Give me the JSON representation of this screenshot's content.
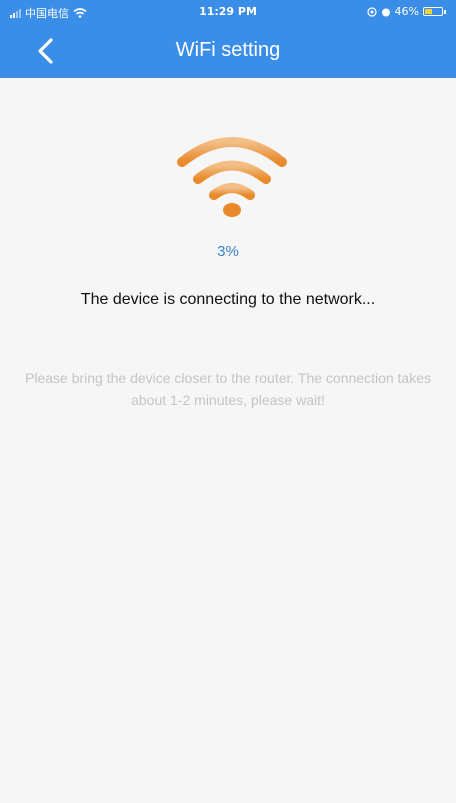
{
  "status_bar": {
    "carrier": "中国电信",
    "time": "11:29 PM",
    "battery": "46%",
    "battery_level": 0.46
  },
  "nav": {
    "title": "WiFi setting",
    "back_icon": "chevron-left-icon"
  },
  "main": {
    "wifi_icon": "wifi-icon",
    "wifi_color": "#e8952f",
    "progress": "3%",
    "status_message": "The device is connecting to the network...",
    "hint": "Please bring the device closer to the router. The connection takes about 1-2 minutes, please wait!"
  },
  "colors": {
    "header": "#3b8ee8",
    "progress": "#3b82c9",
    "background": "#f6f6f6"
  }
}
